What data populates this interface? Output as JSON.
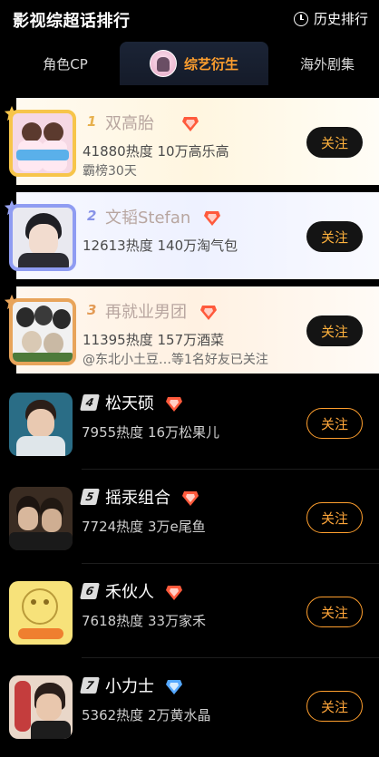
{
  "header": {
    "title": "影视综超话排行",
    "history_label": "历史排行"
  },
  "tabs": [
    {
      "label": "角色CP"
    },
    {
      "label": "综艺衍生",
      "active": true
    },
    {
      "label": "海外剧集"
    }
  ],
  "rows": [
    {
      "rank": "1",
      "name": "双高胎",
      "stats": "41880热度 10万高乐高",
      "sub": "霸榜30天",
      "follow": "关注",
      "badge": "red-gem-icon"
    },
    {
      "rank": "2",
      "name": "文韬Stefan",
      "stats": "12613热度 140万淘气包",
      "sub": "",
      "follow": "关注",
      "badge": "red-gem-icon"
    },
    {
      "rank": "3",
      "name": "再就业男团",
      "stats": "11395热度 157万酒菜",
      "sub": "@东北小土豆…等1名好友已关注",
      "follow": "关注",
      "badge": "red-gem-icon"
    },
    {
      "rank": "4",
      "name": "松天硕",
      "stats": "7955热度 16万松果儿",
      "follow": "关注",
      "badge": "red-gem-icon"
    },
    {
      "rank": "5",
      "name": "摇汞组合",
      "stats": "7724热度 3万e尾鱼",
      "follow": "关注",
      "badge": "red-gem-icon"
    },
    {
      "rank": "6",
      "name": "禾伙人",
      "stats": "7618热度 33万家禾",
      "follow": "关注",
      "badge": "red-gem-icon"
    },
    {
      "rank": "7",
      "name": "小力士",
      "stats": "5362热度 2万黄水晶",
      "follow": "关注",
      "badge": "blue-gem-icon"
    }
  ],
  "colors": {
    "accent": "#ff9f2e",
    "background": "#000000"
  }
}
